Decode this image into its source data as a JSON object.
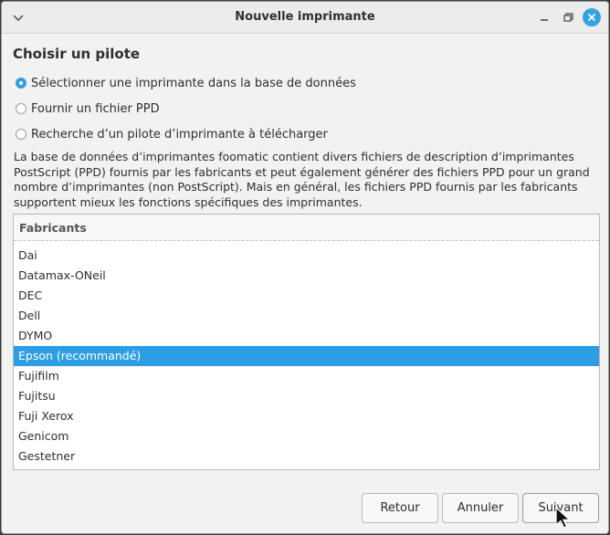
{
  "window": {
    "title": "Nouvelle imprimante"
  },
  "heading": "Choisir un pilote",
  "options": [
    {
      "label": "Sélectionner une imprimante dans la base de données",
      "selected": true
    },
    {
      "label": "Fournir un fichier PPD",
      "selected": false
    },
    {
      "label": "Recherche d’un pilote d’imprimante à télécharger",
      "selected": false
    }
  ],
  "description": "La base de données d’imprimantes foomatic contient divers fichiers de description d’imprimantes PostScript (PPD) fournis par les fabricants et peut également générer des fichiers PPD pour un grand nombre d’imprimantes (non PostScript). Mais en général, les fichiers PPD fournis par les fabricants supportent mieux les fonctions spécifiques des imprimantes.",
  "list": {
    "header": "Fabricants",
    "items": [
      "Dai",
      "Datamax-ONeil",
      "DEC",
      "Dell",
      "DYMO",
      "Epson (recommandé)",
      "Fujifilm",
      "Fujitsu",
      "Fuji Xerox",
      "Genicom",
      "Gestetner"
    ],
    "selected_index": 5
  },
  "buttons": {
    "back": "Retour",
    "cancel": "Annuler",
    "next": "Suivant"
  },
  "colors": {
    "accent": "#2e9ee4",
    "close": "#35a2e0"
  },
  "icons": {
    "menu": "chevron-down-icon",
    "minimize": "minimize-icon",
    "maximize": "restore-icon",
    "close": "close-icon"
  }
}
